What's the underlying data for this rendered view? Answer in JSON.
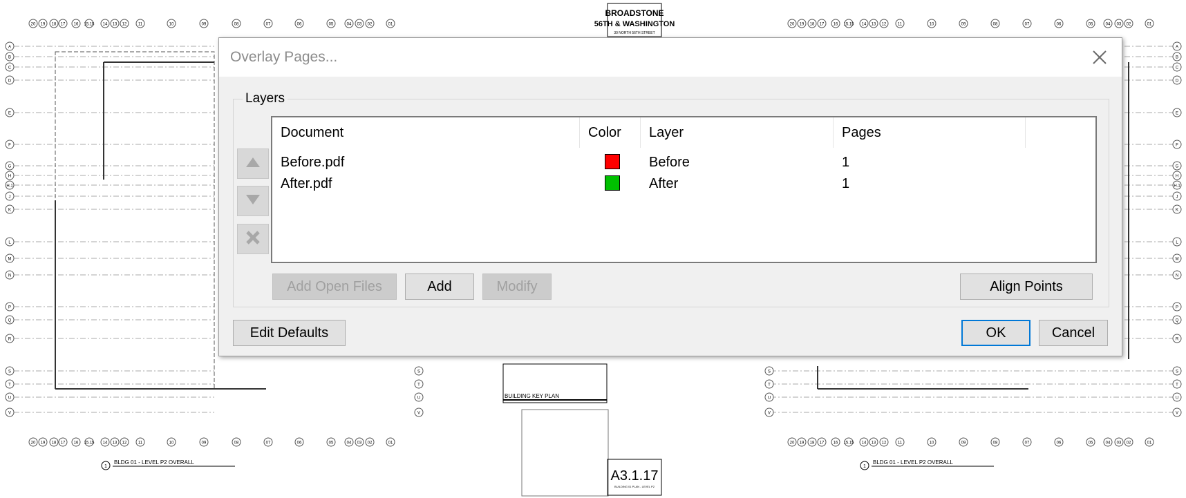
{
  "background": {
    "title_block": {
      "line1": "BROADSTONE",
      "line2": "56TH & WASHINGTON",
      "line3": "30 NORTH 56TH STREET"
    },
    "key_plan_label": "BUILDING KEY PLAN",
    "plan_label": "BLDG 01 - LEVEL P2 OVERALL",
    "sheet_number": "A3.1.17",
    "sheet_title": "BUILDING 01 PLAN - LEVEL P2",
    "detail_number": "1",
    "grid_numbers": [
      "20",
      "19",
      "18",
      "17",
      "16",
      "15.15",
      "14",
      "13",
      "12",
      "11",
      "10",
      "09",
      "08",
      "07",
      "06",
      "05",
      "04",
      "03",
      "02",
      "01"
    ],
    "grid_letters": [
      "A",
      "B",
      "C",
      "D",
      "E",
      "F",
      "G",
      "H",
      "H.1",
      "J",
      "K",
      "L",
      "M",
      "N",
      "P",
      "Q",
      "R",
      "S",
      "T",
      "U",
      "V"
    ]
  },
  "dialog": {
    "title": "Overlay Pages...",
    "close_icon": "close-icon",
    "group_title": "Layers",
    "columns": {
      "document": "Document",
      "color": "Color",
      "layer": "Layer",
      "pages": "Pages"
    },
    "rows": [
      {
        "document": "Before.pdf",
        "color": "#ff0000",
        "layer": "Before",
        "pages": "1"
      },
      {
        "document": "After.pdf",
        "color": "#00c000",
        "layer": "After",
        "pages": "1"
      }
    ],
    "side_buttons": [
      "move-up-icon",
      "move-down-icon",
      "delete-icon"
    ],
    "buttons": {
      "add_open_files": "Add Open Files",
      "add": "Add",
      "modify": "Modify",
      "align_points": "Align Points",
      "edit_defaults": "Edit Defaults",
      "ok": "OK",
      "cancel": "Cancel"
    }
  }
}
